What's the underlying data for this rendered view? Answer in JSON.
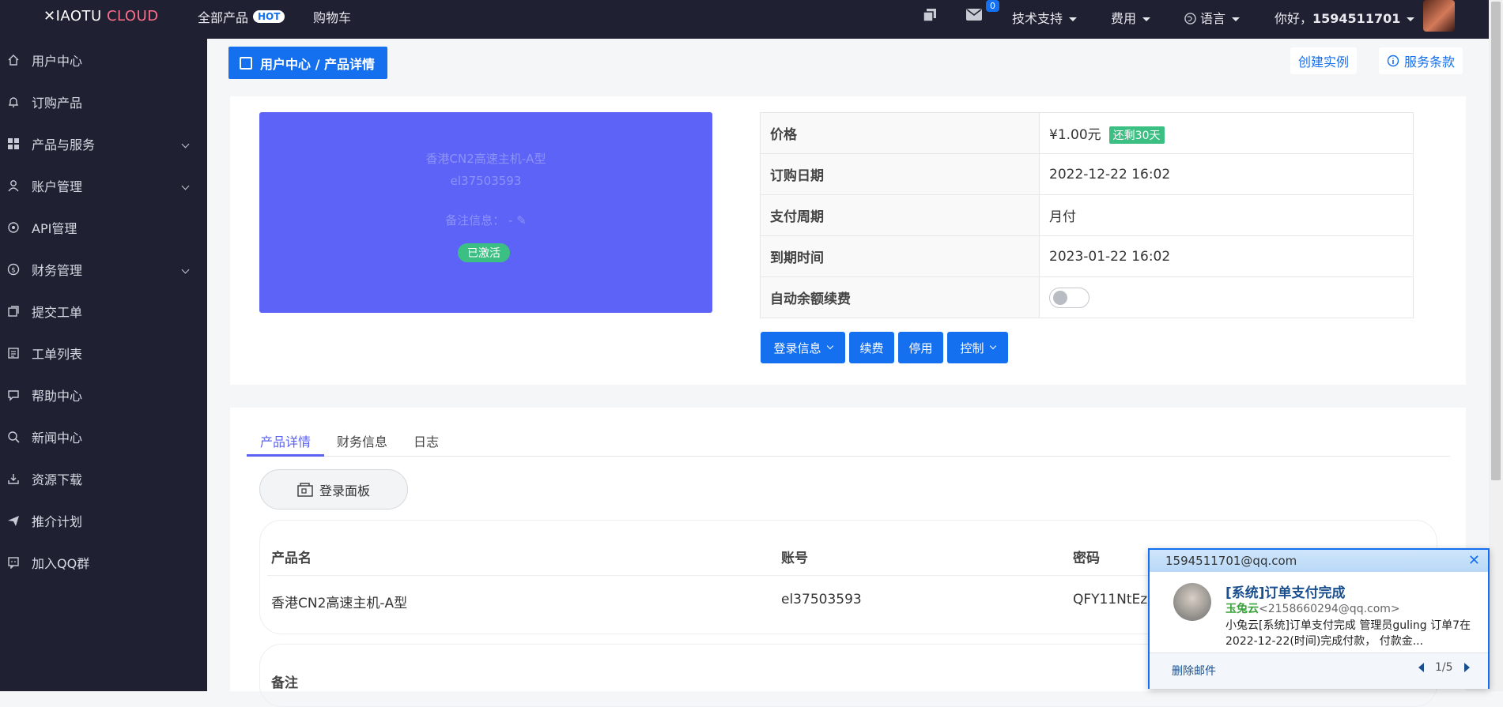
{
  "brand": {
    "x": "✕IAOTU",
    "cloud": "CLOUD"
  },
  "topnav": {
    "all_products": "全部产品",
    "hot": "HOT",
    "cart": "购物车",
    "msg_count": "0",
    "support": "技术支持",
    "fee": "费用",
    "language": "语言",
    "greeting": "你好，",
    "username": "1594511701"
  },
  "sidebar": {
    "items": [
      {
        "label": "用户中心"
      },
      {
        "label": "订购产品"
      },
      {
        "label": "产品与服务"
      },
      {
        "label": "账户管理"
      },
      {
        "label": "API管理"
      },
      {
        "label": "财务管理"
      },
      {
        "label": "提交工单"
      },
      {
        "label": "工单列表"
      },
      {
        "label": "帮助中心"
      },
      {
        "label": "新闻中心"
      },
      {
        "label": "资源下载"
      },
      {
        "label": "推介计划"
      },
      {
        "label": "加入QQ群"
      }
    ]
  },
  "breadcrumb": "用户中心 / 产品详情",
  "header_actions": {
    "create": "创建实例",
    "terms": "服务条款"
  },
  "product_card": {
    "name": "香港CN2高速主机-A型",
    "id": "el37503593",
    "remark": "备注信息：  -",
    "status": "已激活",
    "bg_color": "#5c63f6"
  },
  "info": {
    "price_label": "价格",
    "price_value": "¥1.00元",
    "remain": "还剩30天",
    "order_date_label": "订购日期",
    "order_date": "2022-12-22 16:02",
    "cycle_label": "支付周期",
    "cycle": "月付",
    "expire_label": "到期时间",
    "expire": "2023-01-22 16:02",
    "auto_renew_label": "自动余额续费"
  },
  "actions": {
    "login_info": "登录信息",
    "renew": "续费",
    "stop": "停用",
    "control": "控制"
  },
  "tabs": {
    "detail": "产品详情",
    "finance": "财务信息",
    "log": "日志"
  },
  "panel_btn": "登录面板",
  "credentials": {
    "h_name": "产品名",
    "h_account": "账号",
    "h_password": "密码",
    "name": "香港CN2高速主机-A型",
    "account": "el37503593",
    "password": "QFY11NtEz"
  },
  "note_label": "备注",
  "popup": {
    "email": "1594511701@qq.com",
    "title": "[系统]订单支付完成",
    "from_name": "玉兔云",
    "from_email": "<2158660294@qq.com>",
    "body": "小兔云[系统]订单支付完成 管理员guling   订单7在2022-12-22(时间)完成付款，  付款金...",
    "delete": "删除邮件",
    "pager": "1/5"
  }
}
